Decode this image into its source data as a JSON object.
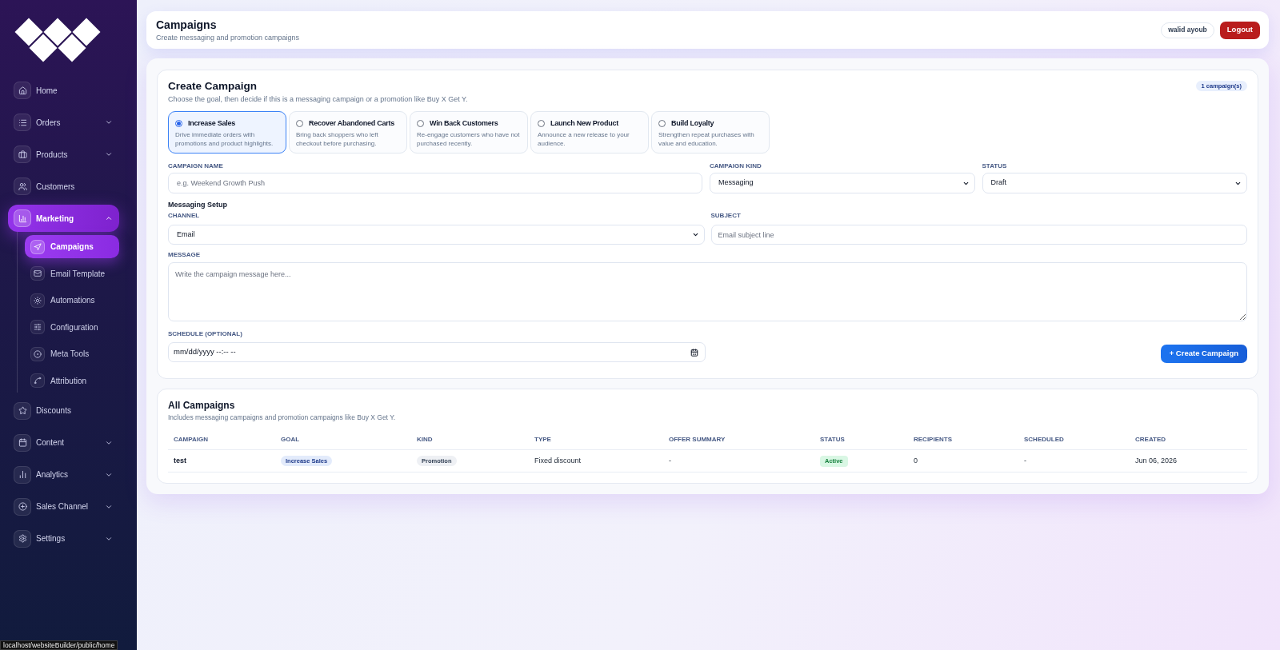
{
  "sidebar": {
    "items": [
      {
        "label": "Home",
        "kind": "link",
        "selected": false
      },
      {
        "label": "Orders",
        "kind": "group",
        "expanded": false,
        "selected": false
      },
      {
        "label": "Products",
        "kind": "group",
        "expanded": false,
        "selected": false
      },
      {
        "label": "Customers",
        "kind": "link",
        "selected": false
      },
      {
        "label": "Marketing",
        "kind": "group",
        "expanded": true,
        "selected": true,
        "children": [
          {
            "label": "Campaigns",
            "selected": true
          },
          {
            "label": "Email Template",
            "selected": false
          },
          {
            "label": "Automations",
            "selected": false
          },
          {
            "label": "Configuration",
            "selected": false
          },
          {
            "label": "Meta Tools",
            "selected": false
          },
          {
            "label": "Attribution",
            "selected": false
          }
        ]
      },
      {
        "label": "Discounts",
        "kind": "link",
        "selected": false
      },
      {
        "label": "Content",
        "kind": "group",
        "expanded": false,
        "selected": false
      },
      {
        "label": "Analytics",
        "kind": "group",
        "expanded": false,
        "selected": false
      },
      {
        "label": "Sales Channel",
        "kind": "group",
        "expanded": false,
        "selected": false
      },
      {
        "label": "Settings",
        "kind": "group",
        "expanded": false,
        "selected": false
      }
    ]
  },
  "header": {
    "title": "Campaigns",
    "subtitle": "Create messaging and promotion campaigns",
    "user": "walid ayoub",
    "logout": "Logout"
  },
  "create_campaign": {
    "title": "Create Campaign",
    "subtitle": "Choose the goal, then decide if this is a messaging campaign or a promotion like Buy X Get Y.",
    "count_badge": "1 campaign(s)",
    "goals": [
      {
        "title": "Increase Sales",
        "description": "Drive immediate orders with promotions and product highlights.",
        "selected": true
      },
      {
        "title": "Recover Abandoned Carts",
        "description": "Bring back shoppers who left checkout before purchasing.",
        "selected": false
      },
      {
        "title": "Win Back Customers",
        "description": "Re-engage customers who have not purchased recently.",
        "selected": false
      },
      {
        "title": "Launch New Product",
        "description": "Announce a new release to your audience.",
        "selected": false
      },
      {
        "title": "Build Loyalty",
        "description": "Strengthen repeat purchases with value and education.",
        "selected": false
      }
    ],
    "campaign_name": {
      "label": "CAMPAIGN NAME",
      "placeholder": "e.g. Weekend Growth Push"
    },
    "campaign_kind": {
      "label": "CAMPAIGN KIND",
      "value": "Messaging"
    },
    "status": {
      "label": "STATUS",
      "value": "Draft"
    },
    "messaging_setup": {
      "title": "Messaging Setup",
      "channel": {
        "label": "CHANNEL",
        "value": "Email"
      },
      "subject": {
        "label": "SUBJECT",
        "placeholder": "Email subject line"
      },
      "message": {
        "label": "MESSAGE",
        "placeholder": "Write the campaign message here..."
      }
    },
    "schedule": {
      "label": "SCHEDULE (OPTIONAL)",
      "placeholder": "mm/dd/yyyy --:-- --"
    },
    "submit": "+ Create Campaign"
  },
  "all_campaigns": {
    "title": "All Campaigns",
    "subtitle": "Includes messaging campaigns and promotion campaigns like Buy X Get Y.",
    "table": {
      "columns": [
        "CAMPAIGN",
        "GOAL",
        "KIND",
        "TYPE",
        "OFFER SUMMARY",
        "STATUS",
        "RECIPIENTS",
        "SCHEDULED",
        "CREATED"
      ],
      "rows": [
        {
          "cells": [
            {
              "kind": "name",
              "text": "test"
            },
            {
              "kind": "goal",
              "text": "Increase Sales"
            },
            {
              "kind": "badge",
              "text": "Promotion"
            },
            {
              "kind": "text",
              "text": "Fixed discount"
            },
            {
              "kind": "text",
              "text": "-"
            },
            {
              "kind": "status",
              "text": "Active"
            },
            {
              "kind": "text",
              "text": "0"
            },
            {
              "kind": "text",
              "text": "-"
            },
            {
              "kind": "text",
              "text": "Jun 06, 2026"
            }
          ]
        }
      ]
    }
  },
  "status_bar": {
    "url": "localhost/websiteBuilder/public/home"
  }
}
